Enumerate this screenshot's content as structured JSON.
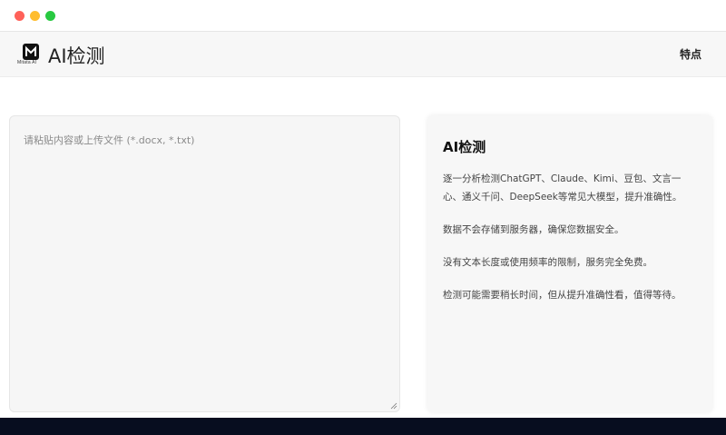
{
  "window": {
    "controls": [
      "close",
      "minimize",
      "maximize"
    ]
  },
  "header": {
    "logo_icon": "mitata-logo-icon",
    "logo_caption": "Mitata AI",
    "title": "AI检测",
    "nav_link": "特点"
  },
  "input": {
    "placeholder": "请粘贴内容或上传文件 (*.docx, *.txt)",
    "value": ""
  },
  "info": {
    "title": "AI检测",
    "paragraphs": [
      "逐一分析检测ChatGPT、Claude、Kimi、豆包、文言一心、通义千问、DeepSeek等常见大模型，提升准确性。",
      "数据不会存储到服务器，确保您数据安全。",
      "没有文本长度或使用频率的限制，服务完全免费。",
      "检测可能需要稍长时间，但从提升准确性看，值得等待。"
    ]
  },
  "colors": {
    "footer": "#070d1f",
    "header_bg": "#f7f7f7",
    "card_bg": "#f6f6f6"
  }
}
